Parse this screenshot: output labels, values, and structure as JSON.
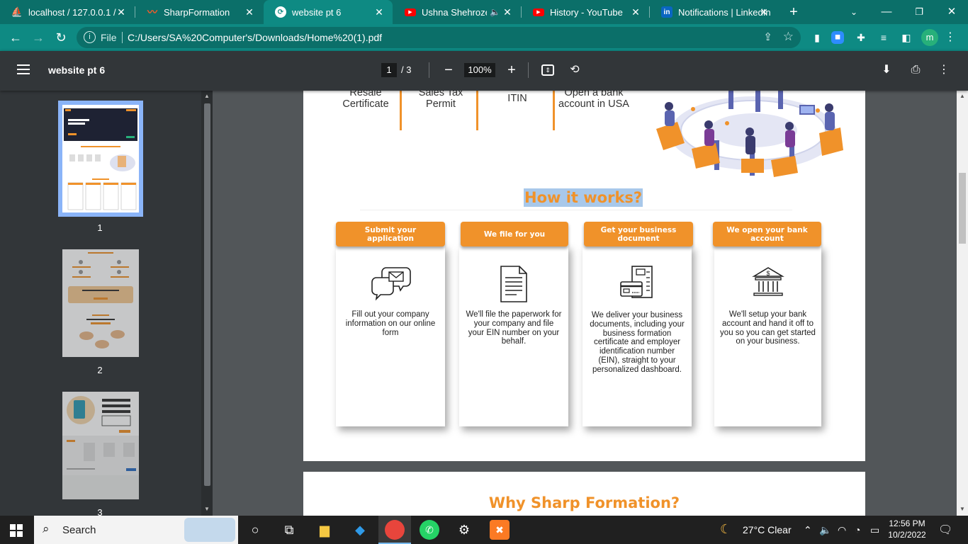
{
  "browser": {
    "tabs": [
      {
        "title": "localhost / 127.0.0.1 /",
        "icon": "phpmyadmin-icon",
        "active": false
      },
      {
        "title": "SharpFormation",
        "icon": "sharpformation-icon",
        "active": false
      },
      {
        "title": "website pt 6",
        "icon": "chrome-pdf-icon",
        "active": true
      },
      {
        "title": "Ushna Shehroze",
        "icon": "youtube-icon",
        "active": false
      },
      {
        "title": "History - YouTube",
        "icon": "youtube-icon",
        "active": false
      },
      {
        "title": "Notifications | LinkedIn",
        "icon": "linkedin-icon",
        "active": false
      }
    ],
    "address": {
      "scheme_label": "File",
      "url": "C:/Users/SA%20Computer's/Downloads/Home%20(1).pdf"
    },
    "profile_initial": "m"
  },
  "pdf_viewer": {
    "title": "website pt 6",
    "current_page": "1",
    "total_pages": "/ 3",
    "zoom": "100%",
    "thumbnails": [
      {
        "label": "1",
        "selected": true
      },
      {
        "label": "2",
        "selected": false
      },
      {
        "label": "3",
        "selected": false
      }
    ]
  },
  "document": {
    "features": [
      {
        "text": "Resale Certificate"
      },
      {
        "text": "Sales Tax Permit"
      },
      {
        "text": "ITIN"
      },
      {
        "text": "Open a bank account in USA"
      }
    ],
    "how_it_works": {
      "title": "How it works?",
      "steps": [
        {
          "heading": "Submit your application",
          "icon": "chat-envelope-icon",
          "text": "Fill out your company information on our online form"
        },
        {
          "heading": "We file for you",
          "icon": "document-icon",
          "text": "We'll file the paperwork for your company and file your EIN number on your behalf."
        },
        {
          "heading": "Get your business document",
          "icon": "business-documents-icon",
          "text": "We deliver your business documents, including your business formation certificate and employer identification number (EIN), straight to your personalized dashboard."
        },
        {
          "heading": "We open your bank account",
          "icon": "bank-icon",
          "text": "We'll setup your bank account and hand it off to you so you can get started on your business."
        }
      ]
    },
    "why_title": "Why Sharp Formation?"
  },
  "taskbar": {
    "search_label": "Search",
    "weather": "27°C  Clear",
    "time": "12:56 PM",
    "date": "10/2/2022"
  },
  "colors": {
    "accent_orange": "#f0922a",
    "chrome_teal": "#0e8a83",
    "pdf_toolbar": "#323639"
  }
}
